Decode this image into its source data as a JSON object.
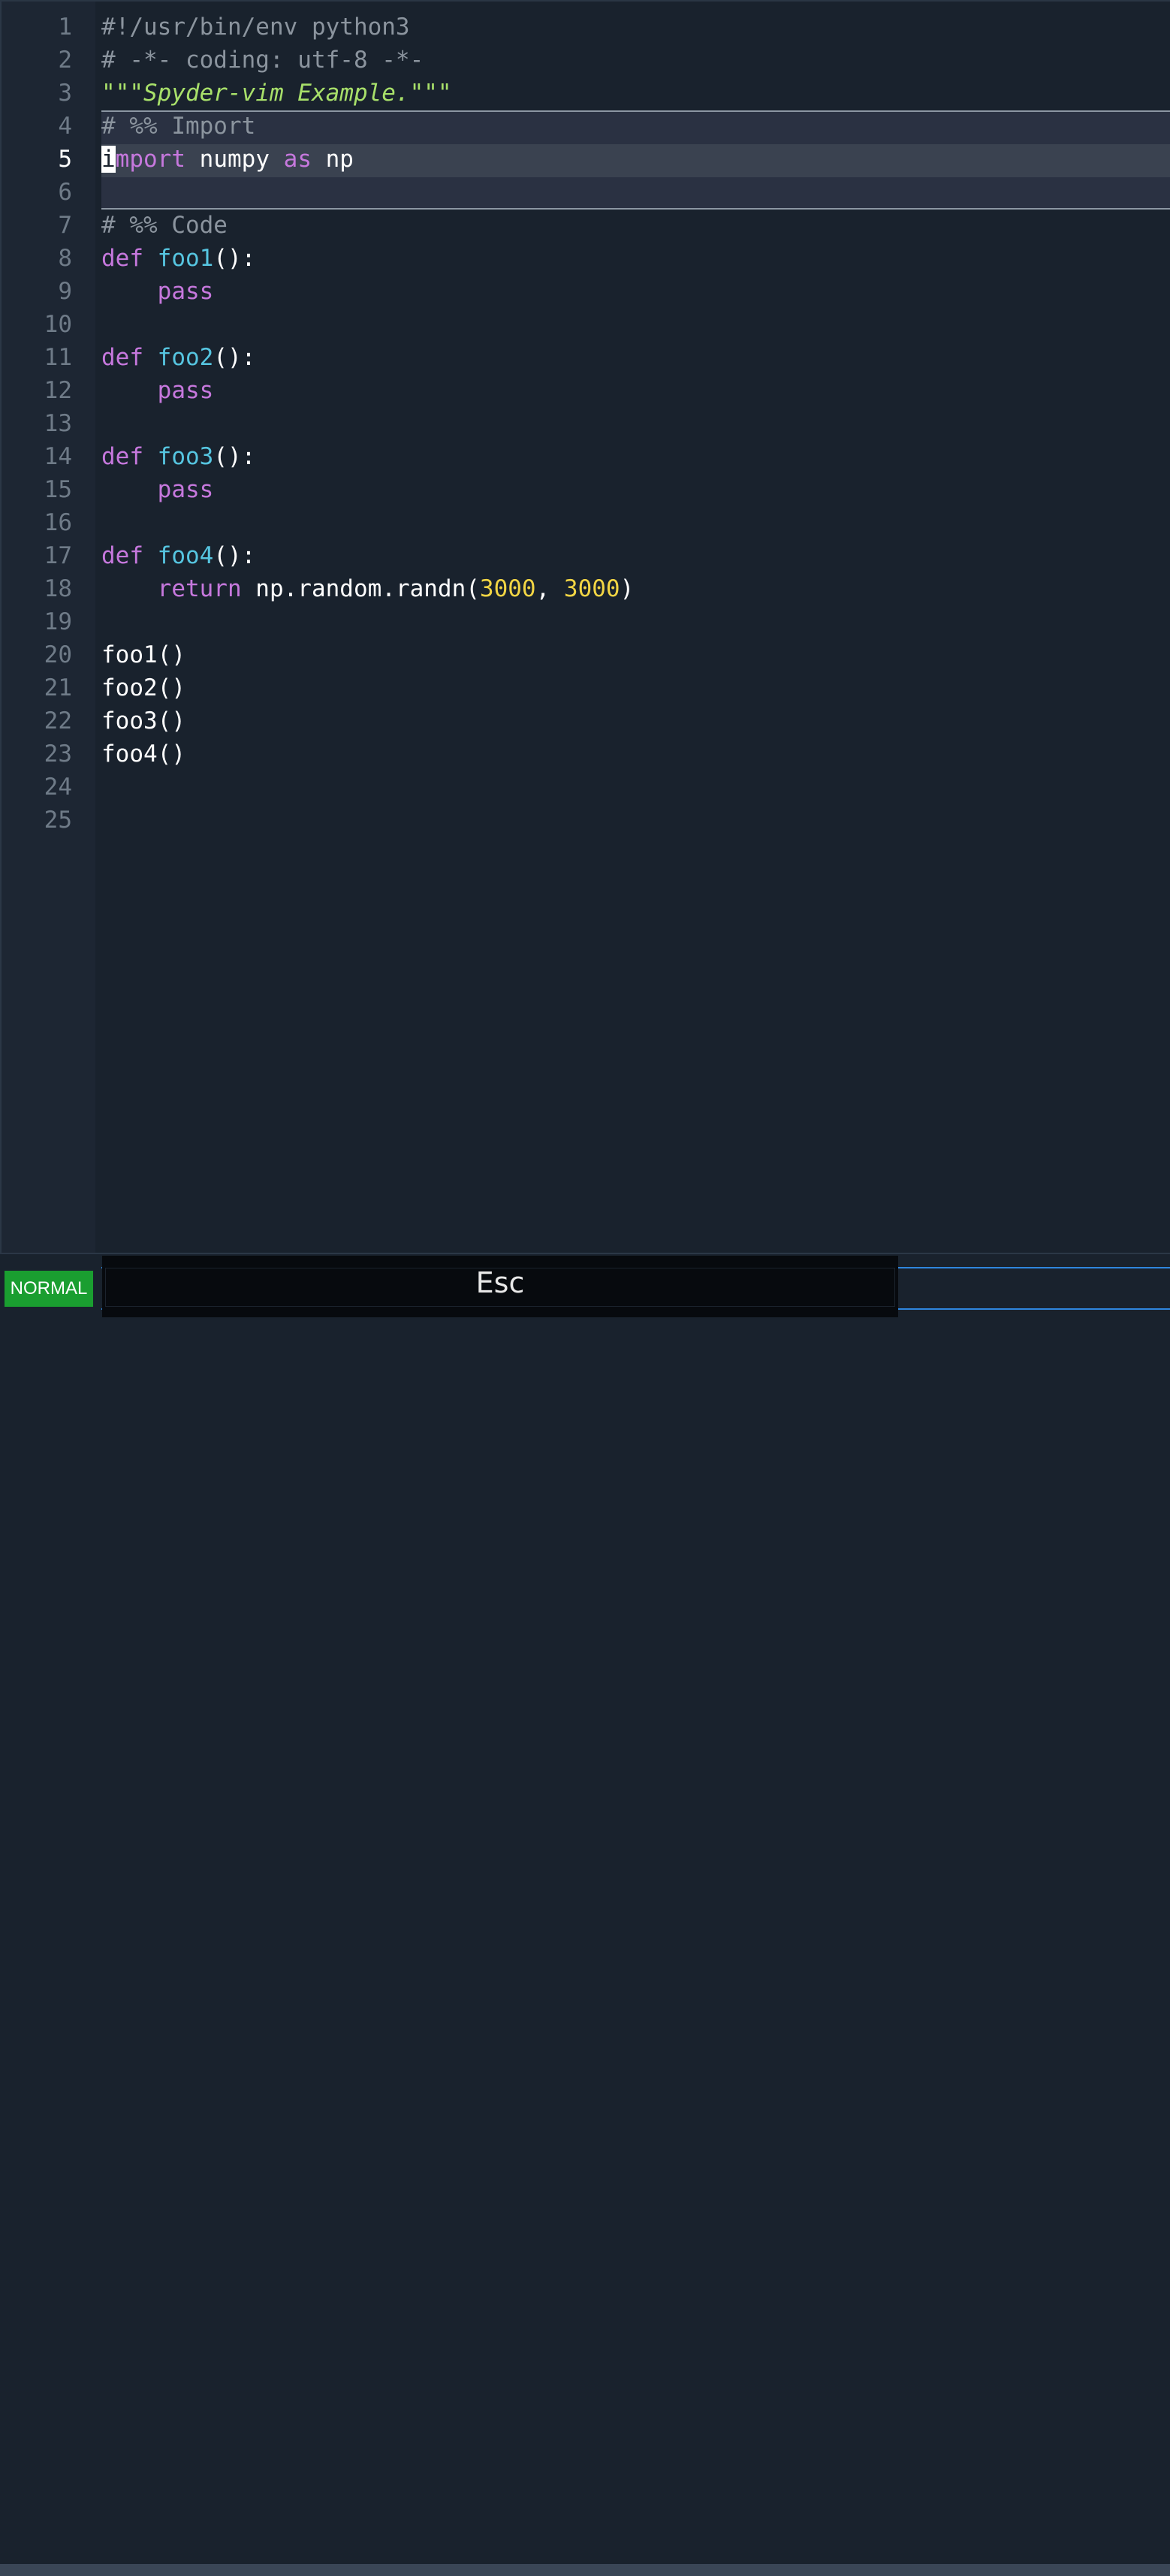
{
  "editor": {
    "current_line": 5,
    "lines": [
      {
        "n": "1",
        "tokens": [
          {
            "t": "#!/usr/bin/env python3",
            "c": "comment"
          }
        ]
      },
      {
        "n": "2",
        "tokens": [
          {
            "t": "# -*- coding: utf-8 -*-",
            "c": "comment"
          }
        ]
      },
      {
        "n": "3",
        "tokens": [
          {
            "t": "\"\"\"Spyder-vim Example.\"\"\"",
            "c": "doc"
          }
        ]
      },
      {
        "n": "4",
        "tokens": [
          {
            "t": "# %% Import",
            "c": "comment"
          }
        ]
      },
      {
        "n": "5",
        "tokens": [
          {
            "t": "i",
            "c": "cursor"
          },
          {
            "t": "mport",
            "c": "kw"
          },
          {
            "t": " numpy ",
            "c": "plain"
          },
          {
            "t": "as",
            "c": "kw"
          },
          {
            "t": " np",
            "c": "plain"
          }
        ]
      },
      {
        "n": "6",
        "tokens": []
      },
      {
        "n": "7",
        "tokens": [
          {
            "t": "# %% Code",
            "c": "comment"
          }
        ]
      },
      {
        "n": "8",
        "tokens": [
          {
            "t": "def",
            "c": "kw"
          },
          {
            "t": " ",
            "c": "plain"
          },
          {
            "t": "foo1",
            "c": "fn"
          },
          {
            "t": "():",
            "c": "plain"
          }
        ]
      },
      {
        "n": "9",
        "tokens": [
          {
            "t": "    ",
            "c": "plain"
          },
          {
            "t": "pass",
            "c": "kw"
          }
        ]
      },
      {
        "n": "10",
        "tokens": []
      },
      {
        "n": "11",
        "tokens": [
          {
            "t": "def",
            "c": "kw"
          },
          {
            "t": " ",
            "c": "plain"
          },
          {
            "t": "foo2",
            "c": "fn"
          },
          {
            "t": "():",
            "c": "plain"
          }
        ]
      },
      {
        "n": "12",
        "tokens": [
          {
            "t": "    ",
            "c": "plain"
          },
          {
            "t": "pass",
            "c": "kw"
          }
        ]
      },
      {
        "n": "13",
        "tokens": []
      },
      {
        "n": "14",
        "tokens": [
          {
            "t": "def",
            "c": "kw"
          },
          {
            "t": " ",
            "c": "plain"
          },
          {
            "t": "foo3",
            "c": "fn"
          },
          {
            "t": "():",
            "c": "plain"
          }
        ]
      },
      {
        "n": "15",
        "tokens": [
          {
            "t": "    ",
            "c": "plain"
          },
          {
            "t": "pass",
            "c": "kw"
          }
        ]
      },
      {
        "n": "16",
        "tokens": []
      },
      {
        "n": "17",
        "tokens": [
          {
            "t": "def",
            "c": "kw"
          },
          {
            "t": " ",
            "c": "plain"
          },
          {
            "t": "foo4",
            "c": "fn"
          },
          {
            "t": "():",
            "c": "plain"
          }
        ]
      },
      {
        "n": "18",
        "tokens": [
          {
            "t": "    ",
            "c": "plain"
          },
          {
            "t": "return",
            "c": "kw"
          },
          {
            "t": " np.random.randn(",
            "c": "plain"
          },
          {
            "t": "3000",
            "c": "num"
          },
          {
            "t": ", ",
            "c": "plain"
          },
          {
            "t": "3000",
            "c": "num"
          },
          {
            "t": ")",
            "c": "plain"
          }
        ]
      },
      {
        "n": "19",
        "tokens": []
      },
      {
        "n": "20",
        "tokens": [
          {
            "t": "foo1()",
            "c": "plain"
          }
        ]
      },
      {
        "n": "21",
        "tokens": [
          {
            "t": "foo2()",
            "c": "plain"
          }
        ]
      },
      {
        "n": "22",
        "tokens": [
          {
            "t": "foo3()",
            "c": "plain"
          }
        ]
      },
      {
        "n": "23",
        "tokens": [
          {
            "t": "foo4()",
            "c": "plain"
          }
        ]
      },
      {
        "n": "24",
        "tokens": []
      },
      {
        "n": "25",
        "tokens": []
      }
    ]
  },
  "statusbar": {
    "mode": "NORMAL",
    "keycast": "Esc"
  },
  "colors": {
    "background": "#19222d",
    "keyword": "#c678dd",
    "function": "#56c5e0",
    "number": "#f2d544",
    "docstring": "#a8e06a",
    "comment": "#8b949e",
    "mode_badge": "#1a9e30"
  }
}
